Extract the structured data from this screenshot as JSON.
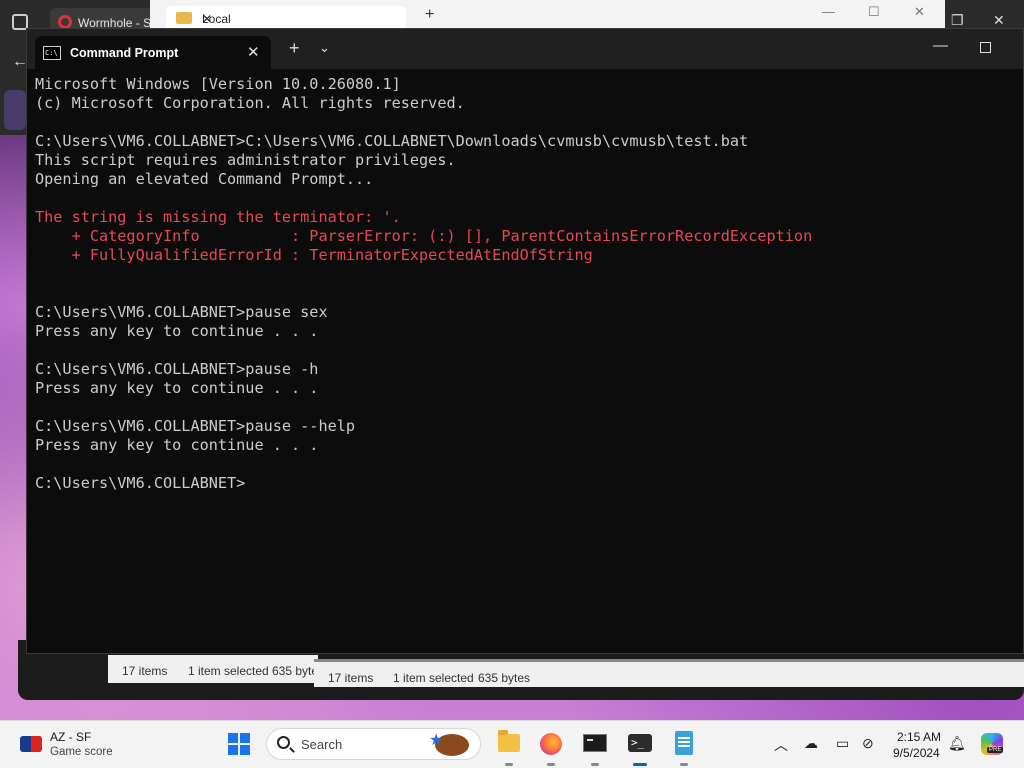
{
  "background": {
    "browser_tab": "Wormhole - Sin",
    "explorer_tab": "Local",
    "explorer_status_1": {
      "items": "17 items",
      "selected": "1 item selected",
      "size": "635 byte"
    },
    "explorer_status_2": {
      "items": "17 items",
      "selected": "1 item selected",
      "size": "635 bytes"
    }
  },
  "terminal": {
    "tab_title": "Command Prompt",
    "icon_label": "C:\\",
    "lines": [
      {
        "text": "Microsoft Windows [Version 10.0.26080.1]",
        "type": "normal"
      },
      {
        "text": "(c) Microsoft Corporation. All rights reserved.",
        "type": "normal"
      },
      {
        "text": "",
        "type": "normal"
      },
      {
        "text": "C:\\Users\\VM6.COLLABNET>C:\\Users\\VM6.COLLABNET\\Downloads\\cvmusb\\cvmusb\\test.bat",
        "type": "normal"
      },
      {
        "text": "This script requires administrator privileges.",
        "type": "normal"
      },
      {
        "text": "Opening an elevated Command Prompt...",
        "type": "normal"
      },
      {
        "text": "",
        "type": "normal"
      },
      {
        "text": "The string is missing the terminator: '.",
        "type": "error"
      },
      {
        "text": "    + CategoryInfo          : ParserError: (:) [], ParentContainsErrorRecordException",
        "type": "error"
      },
      {
        "text": "    + FullyQualifiedErrorId : TerminatorExpectedAtEndOfString",
        "type": "error"
      },
      {
        "text": "",
        "type": "normal"
      },
      {
        "text": "",
        "type": "normal"
      },
      {
        "text": "C:\\Users\\VM6.COLLABNET>pause sex",
        "type": "normal"
      },
      {
        "text": "Press any key to continue . . .",
        "type": "normal"
      },
      {
        "text": "",
        "type": "normal"
      },
      {
        "text": "C:\\Users\\VM6.COLLABNET>pause -h",
        "type": "normal"
      },
      {
        "text": "Press any key to continue . . .",
        "type": "normal"
      },
      {
        "text": "",
        "type": "normal"
      },
      {
        "text": "C:\\Users\\VM6.COLLABNET>pause --help",
        "type": "normal"
      },
      {
        "text": "Press any key to continue . . .",
        "type": "normal"
      },
      {
        "text": "",
        "type": "normal"
      },
      {
        "text": "C:\\Users\\VM6.COLLABNET>",
        "type": "normal"
      }
    ],
    "colors": {
      "background": "#0c0c0c",
      "text": "#cccccc",
      "error": "#e74856"
    }
  },
  "taskbar": {
    "widget": {
      "title": "AZ - SF",
      "subtitle": "Game score"
    },
    "search_placeholder": "Search",
    "apps": [
      "file-explorer-icon",
      "firefox-icon",
      "command-prompt-icon",
      "terminal-icon",
      "notepad-icon"
    ],
    "clock": {
      "time": "2:15 AM",
      "date": "9/5/2024"
    },
    "copilot_badge": "PRE"
  }
}
